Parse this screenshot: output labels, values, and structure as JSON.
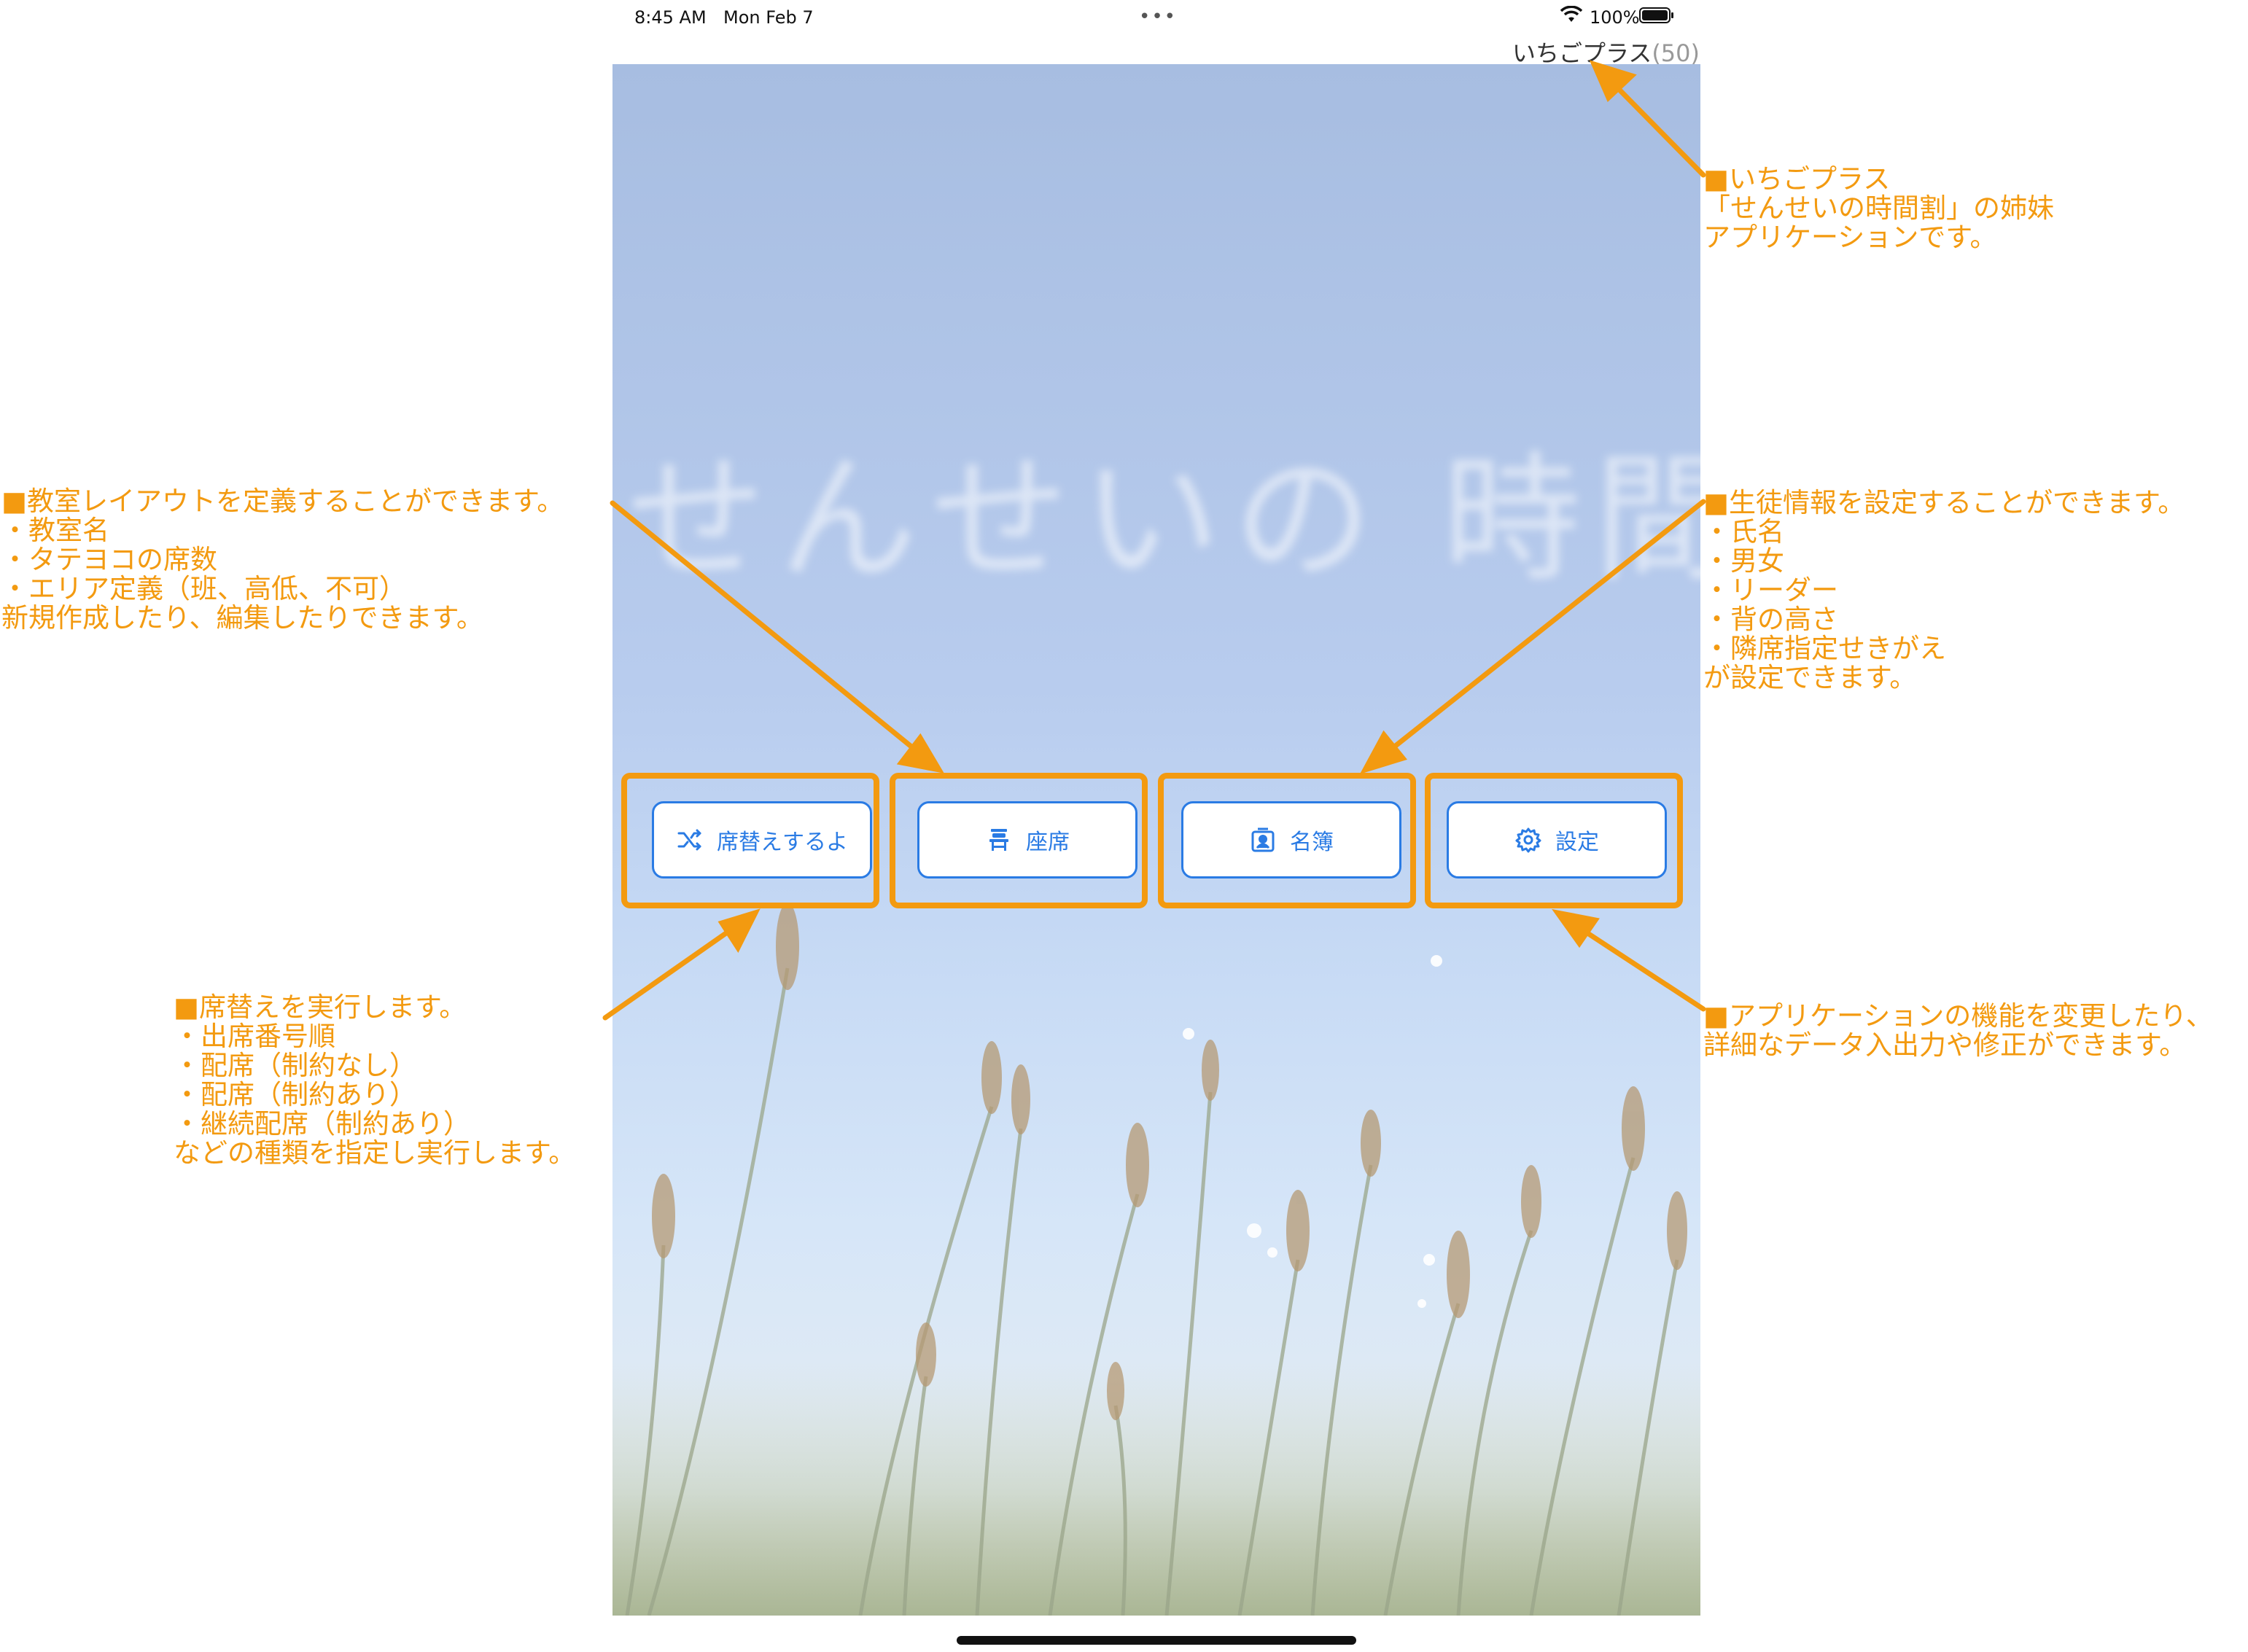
{
  "status_bar": {
    "time": "8:45 AM",
    "date": "Mon Feb 7",
    "battery": "100%",
    "icons": [
      "wifi-icon",
      "battery-icon",
      "more-dots-icon"
    ]
  },
  "app": {
    "title": "いちごプラス",
    "count": "(50)"
  },
  "background": {
    "ghost_title": "せんせいの 時間割"
  },
  "nav": [
    {
      "label": "席替えするよ",
      "icon": "shuffle-icon"
    },
    {
      "label": "座席",
      "icon": "seat-icon"
    },
    {
      "label": "名簿",
      "icon": "roster-icon"
    },
    {
      "label": "設定",
      "icon": "gear-icon"
    }
  ],
  "annotations": {
    "app_info": "■いちごプラス\n「せんせいの時間割」の姉妹\nアプリケーションです。",
    "classroom": "■教室レイアウトを定義することができます。\n・教室名\n・タテヨコの席数\n・エリア定義（班、高低、不可）\n新規作成したり、編集したりできます。",
    "students": "■生徒情報を設定することができます。\n・氏名\n・男女\n・リーダー\n・背の高さ\n・隣席指定せきがえ\nが設定できます。",
    "shuffle": "■席替えを実行します。\n・出席番号順\n・配席（制約なし）\n・配席（制約あり）\n・継続配席（制約あり）\nなどの種類を指定し実行します。",
    "settings": "■アプリケーションの機能を変更したり、\n詳細なデータ入出力や修正ができます。"
  },
  "colors": {
    "annotation": "#f39a10",
    "button_accent": "#2a7be4"
  }
}
